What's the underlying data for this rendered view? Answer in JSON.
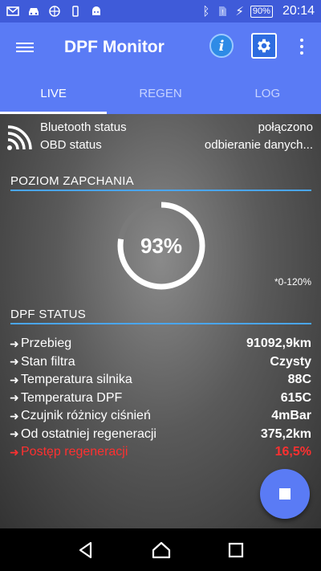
{
  "statusbar": {
    "battery": "90%",
    "time": "20:14"
  },
  "appbar": {
    "title": "DPF Monitor",
    "icons": [
      "menu-icon",
      "info-icon",
      "settings-icon",
      "more-vert-icon"
    ]
  },
  "tabs": [
    {
      "label": "LIVE",
      "active": true
    },
    {
      "label": "REGEN",
      "active": false
    },
    {
      "label": "LOG",
      "active": false
    }
  ],
  "connection": {
    "bluetooth_label": "Bluetooth status",
    "bluetooth_value": "połączono",
    "obd_label": "OBD status",
    "obd_value": "odbieranie danych..."
  },
  "clogging": {
    "title": "POZIOM ZAPCHANIA",
    "value_text": "93%",
    "level_fraction": 0.775,
    "range_note": "*0-120%"
  },
  "dpf_status": {
    "title": "DPF STATUS",
    "rows": [
      {
        "label": "Przebieg",
        "value": "91092,9km"
      },
      {
        "label": "Stan filtra",
        "value": "Czysty"
      },
      {
        "label": "Temperatura silnika",
        "value": "88C"
      },
      {
        "label": "Temperatura DPF",
        "value": "615C"
      },
      {
        "label": "Czujnik różnicy ciśnień",
        "value": "4mBar"
      },
      {
        "label": "Od ostatniej regeneracji",
        "value": "375,2km"
      },
      {
        "label": "Postęp regeneracji",
        "value": "16,5%"
      }
    ]
  },
  "colors": {
    "accent": "#5a7bf5",
    "status_bar": "#3f5bd9",
    "section_underline": "#4aa6f0",
    "highlight_red": "#ff3030"
  }
}
